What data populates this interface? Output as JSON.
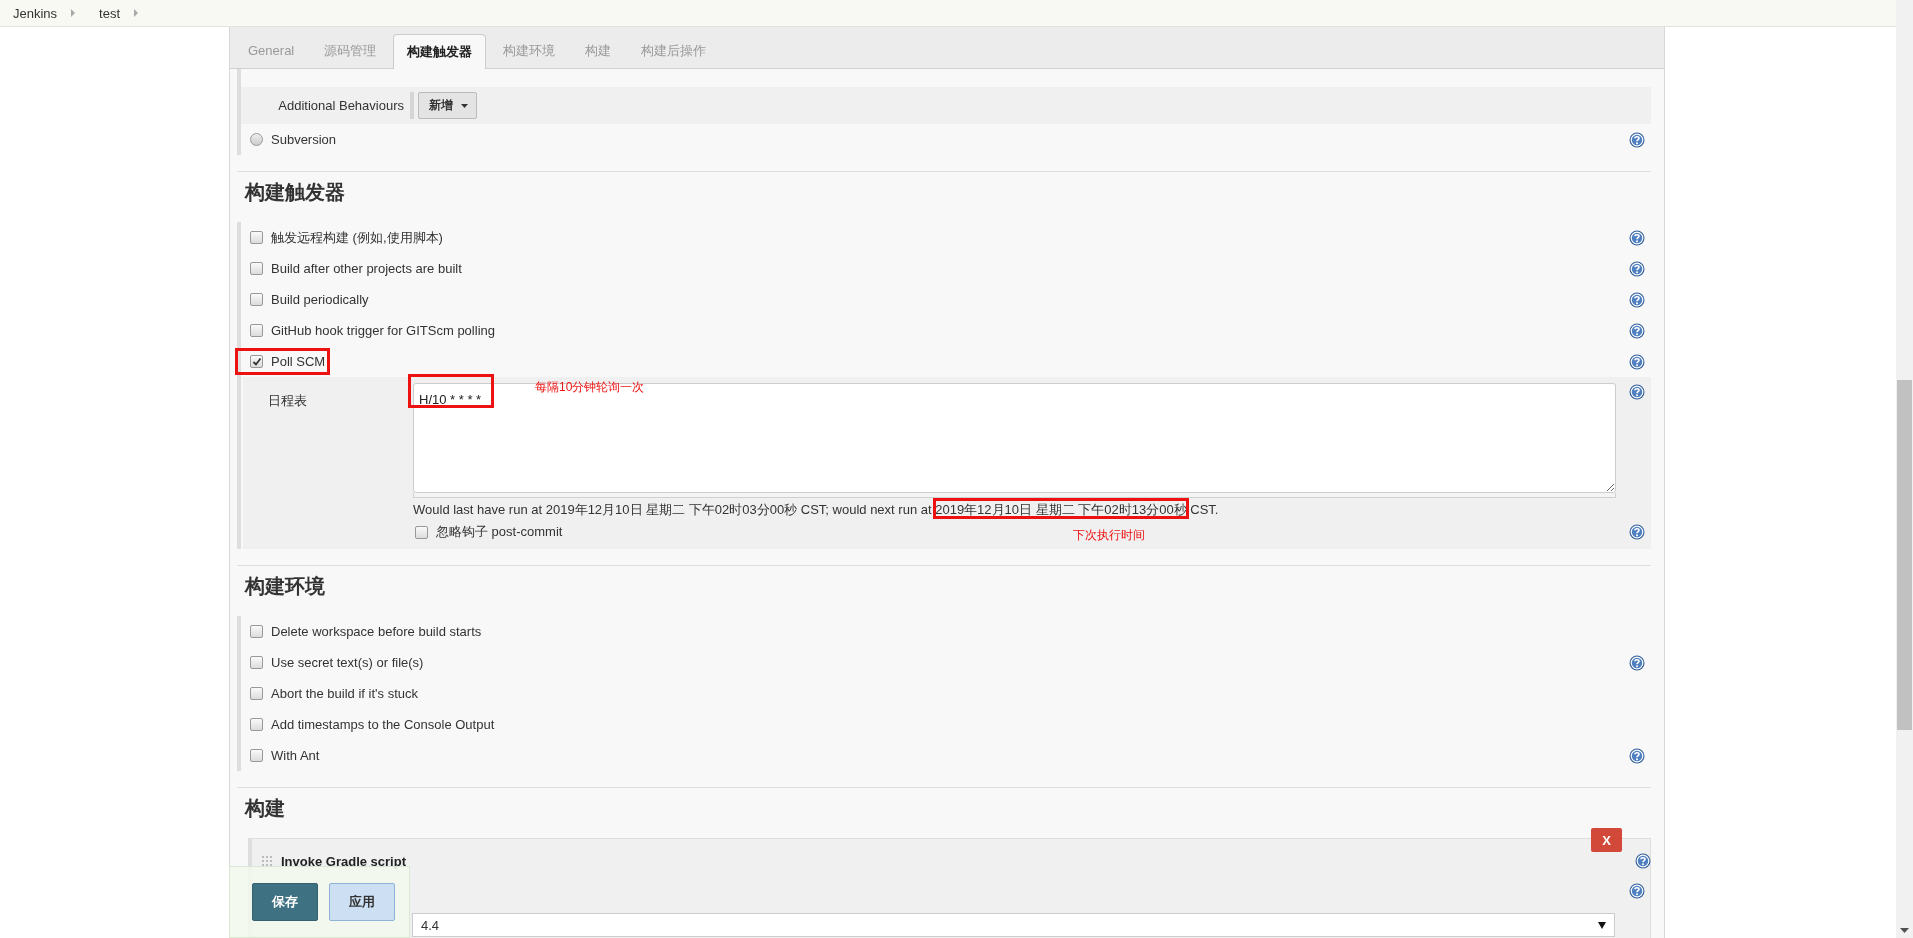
{
  "breadcrumbs": [
    {
      "label": "Jenkins"
    },
    {
      "label": "test"
    }
  ],
  "tabs": [
    {
      "label": "General",
      "selected": false
    },
    {
      "label": "源码管理",
      "selected": false
    },
    {
      "label": "构建触发器",
      "selected": true
    },
    {
      "label": "构建环境",
      "selected": false
    },
    {
      "label": "构建",
      "selected": false
    },
    {
      "label": "构建后操作",
      "selected": false
    }
  ],
  "scm": {
    "additional_behaviours": {
      "label": "Additional Behaviours",
      "button": "新增"
    },
    "options": [
      {
        "label": "Subversion",
        "selected": false,
        "help": true
      }
    ]
  },
  "build_triggers": {
    "title": "构建触发器",
    "options": [
      {
        "label": "触发远程构建 (例如,使用脚本)",
        "checked": false,
        "help": true,
        "highlighted": false
      },
      {
        "label": "Build after other projects are built",
        "checked": false,
        "help": true,
        "highlighted": false
      },
      {
        "label": "Build periodically",
        "checked": false,
        "help": true,
        "highlighted": false
      },
      {
        "label": "GitHub hook trigger for GITScm polling",
        "checked": false,
        "help": true,
        "highlighted": false
      },
      {
        "label": "Poll SCM",
        "checked": true,
        "help": true,
        "highlighted": true
      }
    ],
    "schedule": {
      "label": "日程表",
      "value": "H/10 * * * *",
      "highlighted": true,
      "help": true,
      "annotation": "每隔10分钟轮询一次",
      "note": [
        {
          "text": "Would last have run at 2019年12月10日 星期二 下午02时03分00秒 CST; would next run at ",
          "highlighted": false
        },
        {
          "text": "2019年12月10日 星期二 下午02时13分00秒",
          "highlighted": true
        },
        {
          "text": " CST.",
          "highlighted": false
        }
      ],
      "note_annotation": "下次执行时间",
      "ignore_hooks": {
        "label": "忽略钩子 post-commit",
        "checked": false,
        "help": true
      }
    }
  },
  "build_environment": {
    "title": "构建环境",
    "options": [
      {
        "label": "Delete workspace before build starts",
        "checked": false,
        "help": false
      },
      {
        "label": "Use secret text(s) or file(s)",
        "checked": false,
        "help": true
      },
      {
        "label": "Abort the build if it's stuck",
        "checked": false,
        "help": false
      },
      {
        "label": "Add timestamps to the Console Output",
        "checked": false,
        "help": false
      },
      {
        "label": "With Ant",
        "checked": false,
        "help": true
      }
    ]
  },
  "build": {
    "title": "构建",
    "steps": [
      {
        "title": "Invoke Gradle script",
        "delete_button": "X",
        "help": true,
        "fields": [
          {
            "value": "4.4",
            "help": true
          }
        ]
      }
    ]
  },
  "save_bar": {
    "buttons": [
      {
        "label": "保存",
        "kind": "primary"
      },
      {
        "label": "应用",
        "kind": "secondary"
      }
    ]
  }
}
